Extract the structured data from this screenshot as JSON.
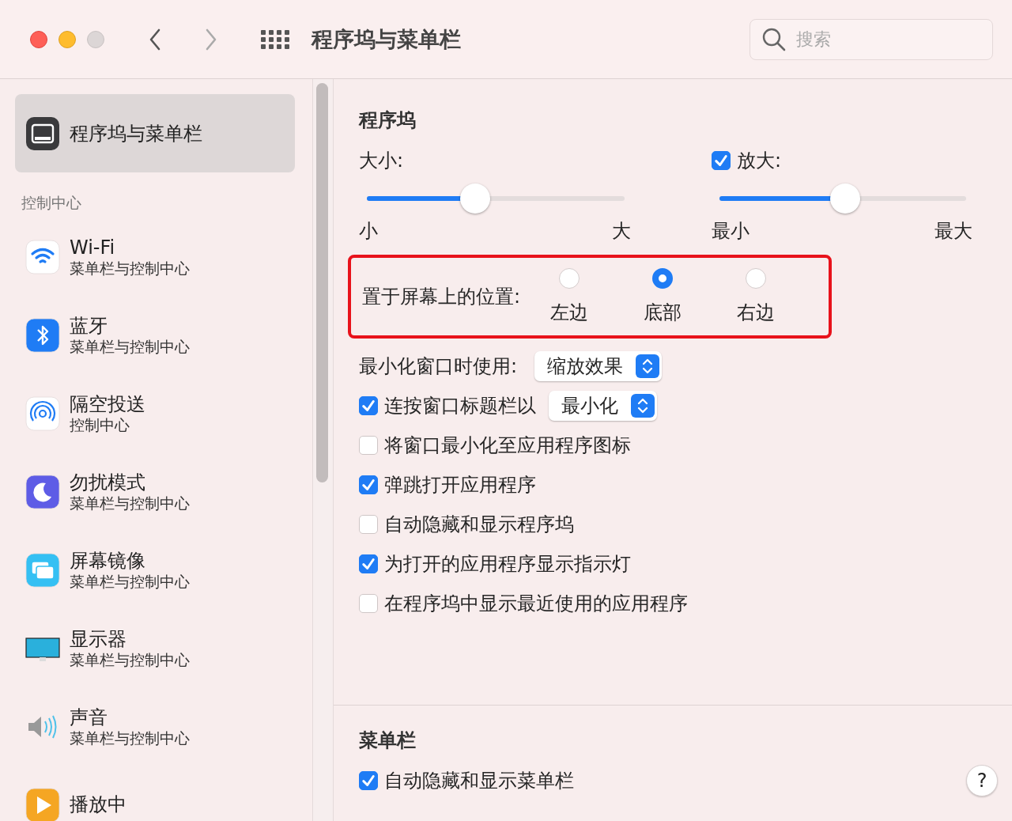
{
  "window": {
    "title": "程序坞与菜单栏"
  },
  "nav": [
    {
      "kind": "back",
      "disabled": false
    },
    {
      "kind": "forward",
      "disabled": true
    }
  ],
  "search": {
    "placeholder": "搜索"
  },
  "sidebar": {
    "current": {
      "title": "程序坞与菜单栏",
      "selected": true
    },
    "section": "控制中心",
    "items": [
      {
        "kind": "wifi",
        "title": "Wi-Fi",
        "subtitle": "菜单栏与控制中心"
      },
      {
        "kind": "bluetooth",
        "title": "蓝牙",
        "subtitle": "菜单栏与控制中心"
      },
      {
        "kind": "airdrop",
        "title": "隔空投送",
        "subtitle": "控制中心"
      },
      {
        "kind": "focus",
        "title": "勿扰模式",
        "subtitle": "菜单栏与控制中心"
      },
      {
        "kind": "mirror",
        "title": "屏幕镜像",
        "subtitle": "菜单栏与控制中心"
      },
      {
        "kind": "display",
        "title": "显示器",
        "subtitle": "菜单栏与控制中心"
      },
      {
        "kind": "sound",
        "title": "声音",
        "subtitle": "菜单栏与控制中心"
      },
      {
        "kind": "play",
        "title": "播放中"
      }
    ]
  },
  "dock": {
    "heading": "程序坞",
    "size": {
      "label": "大小:",
      "level": 0.42,
      "min": "小",
      "max": "大"
    },
    "magnify": {
      "label": "放大:",
      "checked": true,
      "level": 0.51,
      "min": "最小",
      "max": "最大"
    },
    "position": {
      "label": "置于屏幕上的位置:",
      "highlighted": true,
      "options": [
        {
          "label": "左边",
          "selected": false
        },
        {
          "label": "底部",
          "selected": true
        },
        {
          "label": "右边",
          "selected": false
        }
      ]
    },
    "minimize_effect": {
      "label": "最小化窗口时使用:",
      "value": "缩放效果"
    },
    "checkboxes": [
      {
        "label": "连按窗口标题栏以",
        "checked": true,
        "popup": "最小化"
      },
      {
        "label": "将窗口最小化至应用程序图标",
        "checked": false
      },
      {
        "label": "弹跳打开应用程序",
        "checked": true
      },
      {
        "label": "自动隐藏和显示程序坞",
        "checked": false
      },
      {
        "label": "为打开的应用程序显示指示灯",
        "checked": true
      },
      {
        "label": "在程序坞中显示最近使用的应用程序",
        "checked": false
      }
    ]
  },
  "menubar": {
    "heading": "菜单栏",
    "checkboxes": [
      {
        "label": "自动隐藏和显示菜单栏",
        "checked": true
      }
    ]
  },
  "help": {
    "label": "?"
  }
}
